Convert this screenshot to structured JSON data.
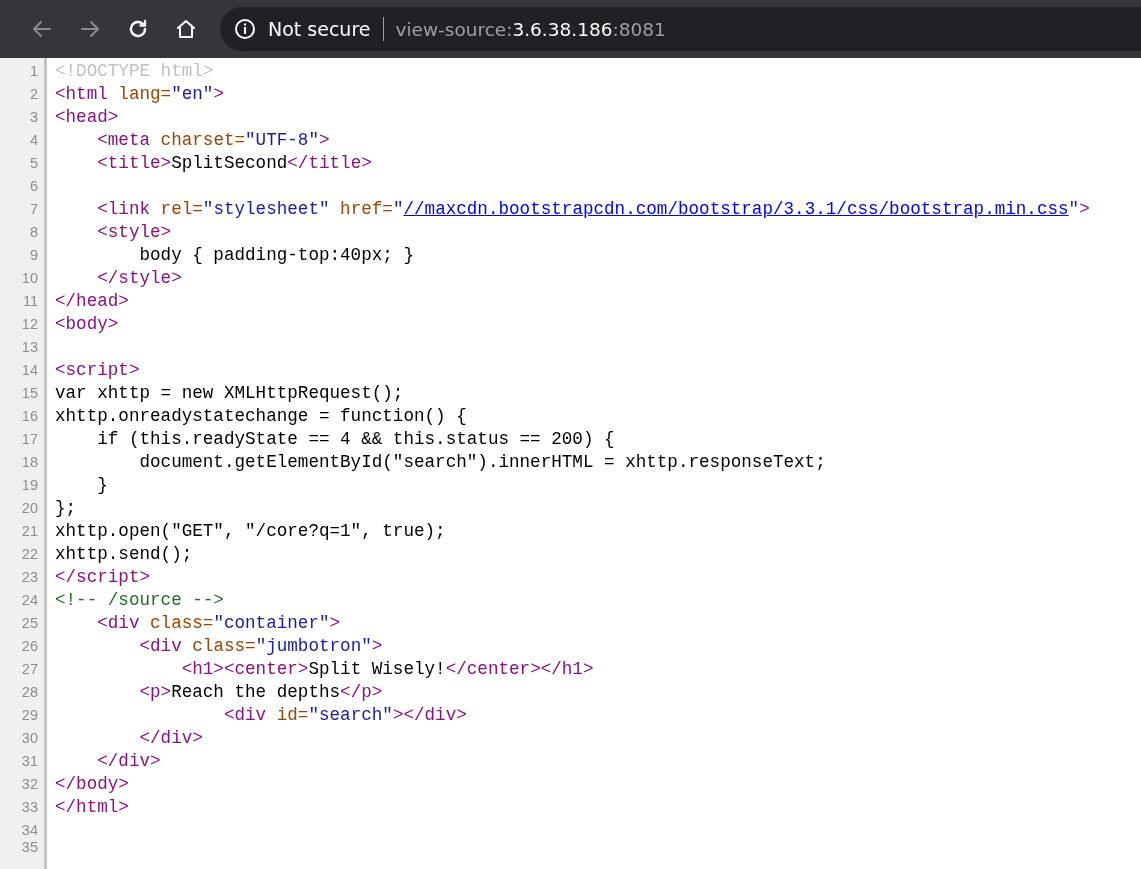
{
  "toolbar": {
    "nav_buttons": [
      {
        "kind": "back",
        "disabled": true
      },
      {
        "kind": "forward",
        "disabled": true
      },
      {
        "kind": "reload",
        "disabled": false
      },
      {
        "kind": "home",
        "disabled": false
      }
    ],
    "address_bar": {
      "security_label": "Not secure",
      "url_parts": [
        {
          "text": "view-source:",
          "emphasis": false
        },
        {
          "text": "3.6.38.186",
          "emphasis": true
        },
        {
          "text": ":8081",
          "emphasis": false
        }
      ]
    }
  },
  "source": {
    "lines": [
      {
        "number": "1",
        "tokens": [
          {
            "kind": "doctype",
            "text": "<!DOCTYPE html>"
          }
        ]
      },
      {
        "number": "2",
        "tokens": [
          {
            "kind": "tag",
            "text": "<html "
          },
          {
            "kind": "attr",
            "text": "lang="
          },
          {
            "kind": "value",
            "text": "\"en\""
          },
          {
            "kind": "tag",
            "text": ">"
          }
        ]
      },
      {
        "number": "3",
        "tokens": [
          {
            "kind": "tag",
            "text": "<head>"
          }
        ]
      },
      {
        "number": "4",
        "tokens": [
          {
            "kind": "tag",
            "text": "    <meta "
          },
          {
            "kind": "attr",
            "text": "charset="
          },
          {
            "kind": "value",
            "text": "\"UTF-8\""
          },
          {
            "kind": "tag",
            "text": ">"
          }
        ]
      },
      {
        "number": "5",
        "tokens": [
          {
            "kind": "tag",
            "text": "    <title>"
          },
          {
            "kind": "text",
            "text": "SplitSecond"
          },
          {
            "kind": "tag",
            "text": "</title>"
          }
        ]
      },
      {
        "number": "6"
      },
      {
        "number": "7",
        "tokens": [
          {
            "kind": "tag",
            "text": "    <link "
          },
          {
            "kind": "attr",
            "text": "rel="
          },
          {
            "kind": "value",
            "text": "\"stylesheet\" "
          },
          {
            "kind": "attr",
            "text": "href="
          },
          {
            "kind": "value",
            "text": "\""
          },
          {
            "kind": "link",
            "text": "//maxcdn.bootstrapcdn.com/bootstrap/3.3.1/css/bootstrap.min.css"
          },
          {
            "kind": "value",
            "text": "\""
          },
          {
            "kind": "tag",
            "text": ">"
          }
        ]
      },
      {
        "number": "8",
        "tokens": [
          {
            "kind": "tag",
            "text": "    <style>"
          }
        ]
      },
      {
        "number": "9",
        "tokens": [
          {
            "kind": "text",
            "text": "        body { padding-top:40px; }"
          }
        ]
      },
      {
        "number": "10",
        "tokens": [
          {
            "kind": "tag",
            "text": "    </style>"
          }
        ]
      },
      {
        "number": "11",
        "tokens": [
          {
            "kind": "tag",
            "text": "</head>"
          }
        ]
      },
      {
        "number": "12",
        "tokens": [
          {
            "kind": "tag",
            "text": "<body>"
          }
        ]
      },
      {
        "number": "13"
      },
      {
        "number": "14",
        "tokens": [
          {
            "kind": "tag",
            "text": "<script>"
          }
        ]
      },
      {
        "number": "15",
        "tokens": [
          {
            "kind": "text",
            "text": "var xhttp = new XMLHttpRequest();"
          }
        ]
      },
      {
        "number": "16",
        "tokens": [
          {
            "kind": "text",
            "text": "xhttp.onreadystatechange = function() {"
          }
        ]
      },
      {
        "number": "17",
        "tokens": [
          {
            "kind": "text",
            "text": "    if (this.readyState == 4 && this.status == 200) {"
          }
        ]
      },
      {
        "number": "18",
        "tokens": [
          {
            "kind": "text",
            "text": "        document.getElementById(\"search\").innerHTML = xhttp.responseText;"
          }
        ]
      },
      {
        "number": "19",
        "tokens": [
          {
            "kind": "text",
            "text": "    }"
          }
        ]
      },
      {
        "number": "20",
        "tokens": [
          {
            "kind": "text",
            "text": "};"
          }
        ]
      },
      {
        "number": "21",
        "tokens": [
          {
            "kind": "text",
            "text": "xhttp.open(\"GET\", \"/core?q=1\", true);"
          }
        ]
      },
      {
        "number": "22",
        "tokens": [
          {
            "kind": "text",
            "text": "xhttp.send();"
          }
        ]
      },
      {
        "number": "23",
        "tokens": [
          {
            "kind": "tag",
            "text": "</script>"
          }
        ]
      },
      {
        "number": "24",
        "tokens": [
          {
            "kind": "comment",
            "text": "<!-- /source -->"
          }
        ]
      },
      {
        "number": "25",
        "tokens": [
          {
            "kind": "tag",
            "text": "    <div "
          },
          {
            "kind": "attr",
            "text": "class="
          },
          {
            "kind": "value",
            "text": "\"container\""
          },
          {
            "kind": "tag",
            "text": ">"
          }
        ]
      },
      {
        "number": "26",
        "tokens": [
          {
            "kind": "tag",
            "text": "        <div "
          },
          {
            "kind": "attr",
            "text": "class="
          },
          {
            "kind": "value",
            "text": "\"jumbotron\""
          },
          {
            "kind": "tag",
            "text": ">"
          }
        ]
      },
      {
        "number": "27",
        "tokens": [
          {
            "kind": "tag",
            "text": "            <h1><center>"
          },
          {
            "kind": "text",
            "text": "Split Wisely!"
          },
          {
            "kind": "tag",
            "text": "</center></h1>"
          }
        ]
      },
      {
        "number": "28",
        "tokens": [
          {
            "kind": "tag",
            "text": "        <p>"
          },
          {
            "kind": "text",
            "text": "Reach the depths"
          },
          {
            "kind": "tag",
            "text": "</p>"
          }
        ]
      },
      {
        "number": "29",
        "tokens": [
          {
            "kind": "tag",
            "text": "                <div "
          },
          {
            "kind": "attr",
            "text": "id="
          },
          {
            "kind": "value",
            "text": "\"search\""
          },
          {
            "kind": "tag",
            "text": "></div>"
          }
        ]
      },
      {
        "number": "30",
        "tokens": [
          {
            "kind": "tag",
            "text": "        </div>"
          }
        ]
      },
      {
        "number": "31",
        "tokens": [
          {
            "kind": "tag",
            "text": "    </div>"
          }
        ]
      },
      {
        "number": "32",
        "tokens": [
          {
            "kind": "tag",
            "text": "</body>"
          }
        ]
      },
      {
        "number": "33",
        "tokens": [
          {
            "kind": "tag",
            "text": "</html>"
          }
        ]
      },
      {
        "number": "34"
      },
      {
        "number": "35"
      }
    ]
  }
}
